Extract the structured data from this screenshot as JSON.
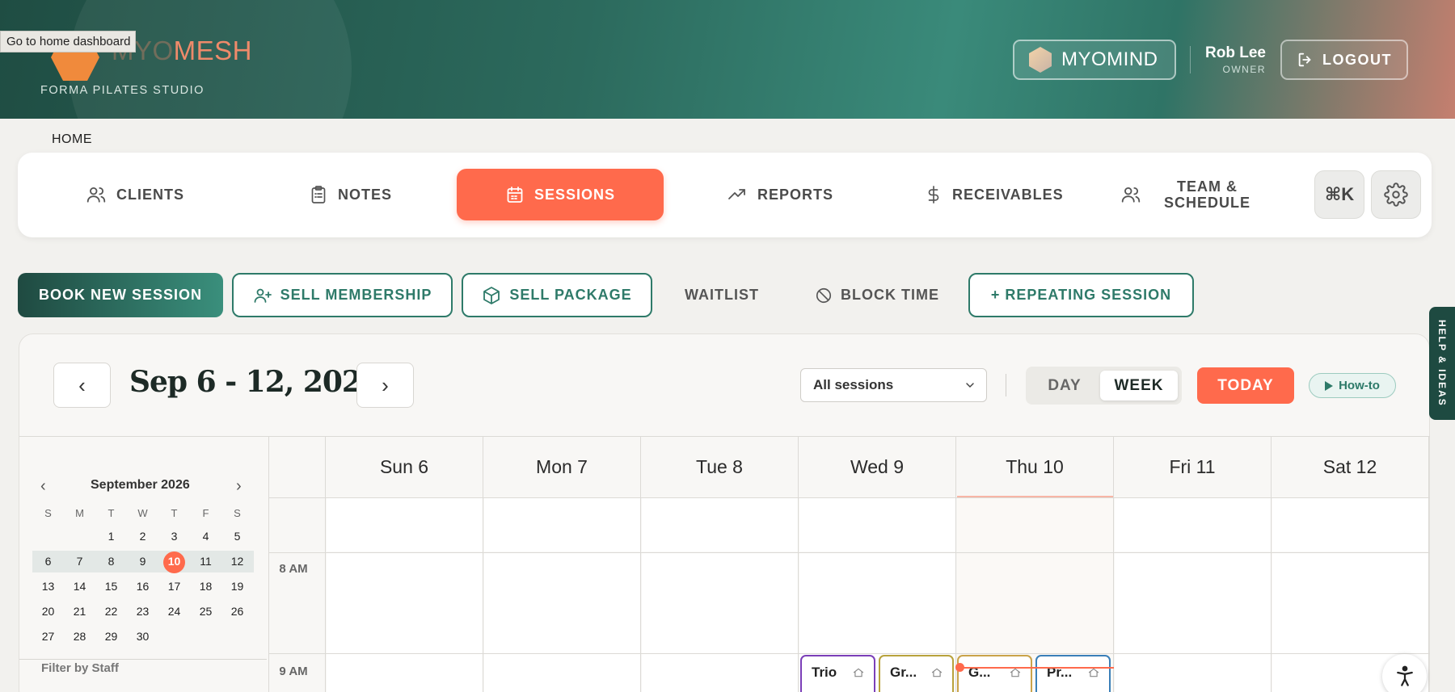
{
  "header": {
    "tooltip": "Go to home dashboard",
    "logo_text_faint": "MYO",
    "logo_text": "MESH",
    "studio_name": "FORMA PILATES STUDIO",
    "myomind_label": "MYOMIND",
    "user_name": "Rob Lee",
    "user_role": "OWNER",
    "logout_label": "LOGOUT"
  },
  "breadcrumb": "HOME",
  "nav": {
    "items": [
      {
        "label": "CLIENTS",
        "icon": "users-icon"
      },
      {
        "label": "NOTES",
        "icon": "clipboard-icon"
      },
      {
        "label": "SESSIONS",
        "icon": "calendar-icon",
        "active": true
      },
      {
        "label": "REPORTS",
        "icon": "trending-up-icon"
      },
      {
        "label": "RECEIVABLES",
        "icon": "dollar-icon"
      },
      {
        "label_line1": "TEAM &",
        "label_line2": "SCHEDULE",
        "icon": "team-icon"
      }
    ],
    "shortcut_label": "⌘K",
    "settings_icon": "gear-icon"
  },
  "actions": {
    "book": "BOOK NEW SESSION",
    "membership": "SELL MEMBERSHIP",
    "package": "SELL PACKAGE",
    "waitlist": "WAITLIST",
    "block": "BLOCK TIME",
    "repeating": "+ REPEATING SESSION"
  },
  "calendar": {
    "prev": "‹",
    "next": "›",
    "range_title": "Sep 6 - 12, 2026",
    "filter_value": "All sessions",
    "view_day": "DAY",
    "view_week": "WEEK",
    "active_view": "WEEK",
    "today": "TODAY",
    "howto": "How-to",
    "help_tab": "HELP & IDEAS",
    "days": [
      "Sun 6",
      "Mon 7",
      "Tue 8",
      "Wed 9",
      "Thu 10",
      "Fri 11",
      "Sat 12"
    ],
    "current_day": "Thu 10",
    "times": [
      "8 AM",
      "9 AM"
    ],
    "events": [
      {
        "title": "Trio",
        "color": "#7b3fb8"
      },
      {
        "title": "Gr...",
        "color": "#b8a23c"
      },
      {
        "title": "G...",
        "color": "#c9a34a"
      },
      {
        "title": "Pr...",
        "color": "#3a7fb8"
      }
    ]
  },
  "mini_calendar": {
    "month": "September 2026",
    "prev": "‹",
    "next": "›",
    "dow": [
      "S",
      "M",
      "T",
      "W",
      "T",
      "F",
      "S"
    ],
    "weeks": [
      [
        "",
        "",
        "1",
        "2",
        "3",
        "4",
        "5"
      ],
      [
        "6",
        "7",
        "8",
        "9",
        "10",
        "11",
        "12"
      ],
      [
        "13",
        "14",
        "15",
        "16",
        "17",
        "18",
        "19"
      ],
      [
        "20",
        "21",
        "22",
        "23",
        "24",
        "25",
        "26"
      ],
      [
        "27",
        "28",
        "29",
        "30",
        "",
        "",
        ""
      ]
    ],
    "today": "10",
    "filter_label": "Filter by Staff"
  },
  "colors": {
    "accent": "#ff6a4c",
    "brand_dark": "#1f4a41",
    "brand_teal": "#2e7a69"
  }
}
